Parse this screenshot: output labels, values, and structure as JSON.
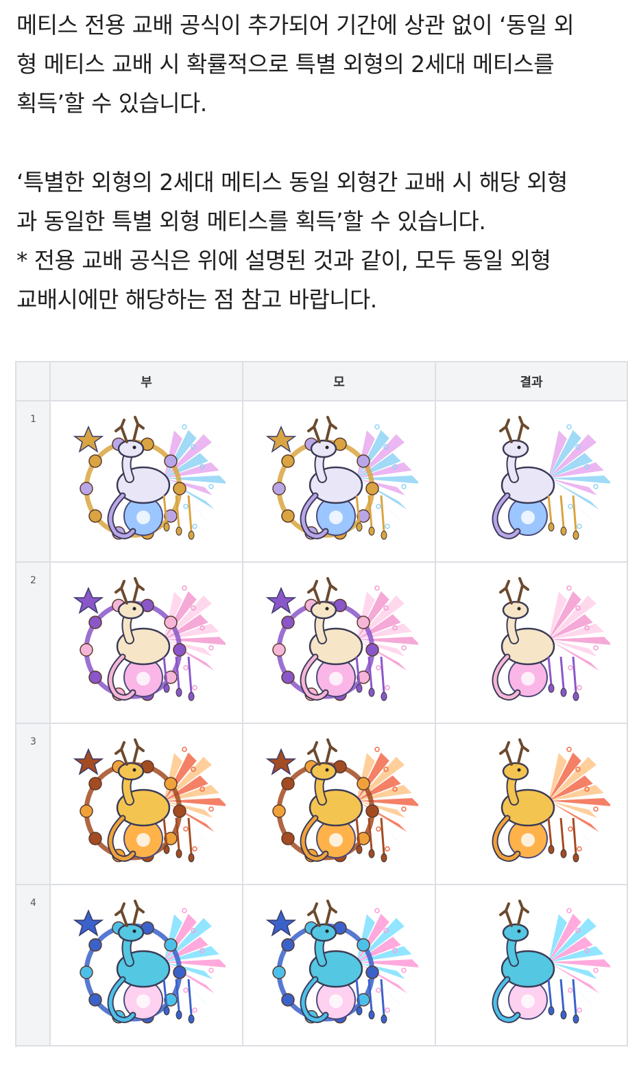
{
  "paragraph1": {
    "lines": [
      "메티스 전용 교배 공식이 추가되어 기간에 상관 없이 ‘동일 외",
      "형 메티스 교배 시 확률적으로 특별 외형의 2세대 메티스를",
      "획득’할 수 있습니다."
    ]
  },
  "paragraph2": {
    "lines": [
      "‘특별한 외형의 2세대 메티스 동일 외형간 교배 시 해당 외형",
      "과 동일한 특별 외형 메티스를 획득’할 수 있습니다.",
      " * 전용 교배 공식은 위에 설명된 것과 같이, 모두 동일 외형",
      "교배시에만 해당하는 점 참고 바랍니다."
    ]
  },
  "table": {
    "headers": [
      "",
      "부",
      "모",
      "결과"
    ],
    "rows": [
      {
        "index": "1",
        "theme": {
          "primary": "#b9a6e8",
          "wing1": "#8fd3f5",
          "wing2": "#e7a9ef",
          "orb": "#9cc6ff",
          "accent": "#d9a441",
          "body": "#e9e6f7"
        }
      },
      {
        "index": "2",
        "theme": {
          "primary": "#f6b6d8",
          "wing1": "#f39ad0",
          "wing2": "#ffd1ea",
          "orb": "#f9b6e6",
          "accent": "#8a57c9",
          "body": "#f6e6c7"
        }
      },
      {
        "index": "3",
        "theme": {
          "primary": "#f0a23a",
          "wing1": "#f26a4b",
          "wing2": "#ffc789",
          "orb": "#ffb24a",
          "accent": "#a34b22",
          "body": "#f4c451"
        }
      },
      {
        "index": "4",
        "theme": {
          "primary": "#4dc0ea",
          "wing1": "#ff9ad6",
          "wing2": "#7ee0ff",
          "orb": "#ffd1f0",
          "accent": "#3a62c9",
          "body": "#54c7e2"
        }
      }
    ]
  }
}
